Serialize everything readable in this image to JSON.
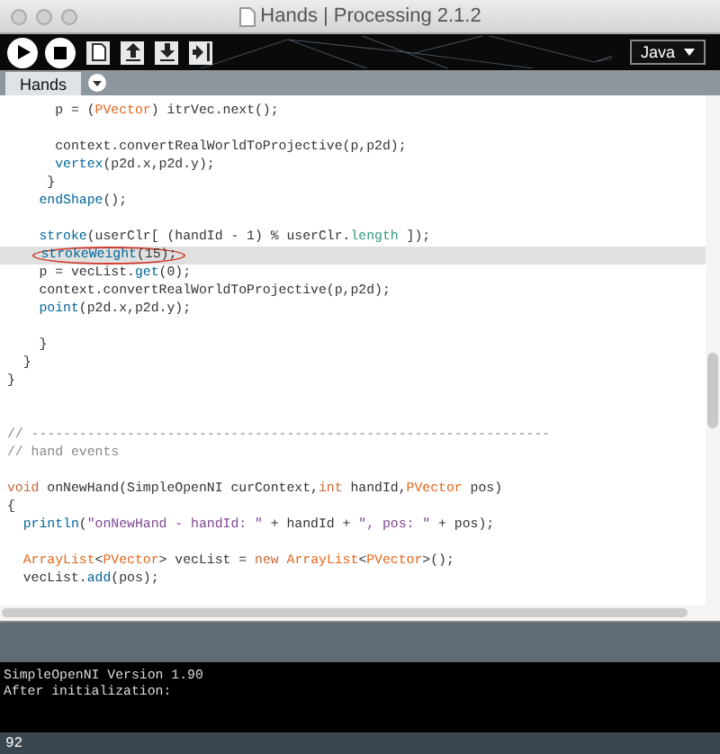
{
  "window": {
    "title": "Hands | Processing 2.1.2"
  },
  "toolbar": {
    "buttons": [
      {
        "kind": "run"
      },
      {
        "kind": "stop"
      },
      {
        "kind": "new"
      },
      {
        "kind": "open"
      },
      {
        "kind": "save"
      },
      {
        "kind": "export"
      }
    ],
    "mode": "Java"
  },
  "tabs": [
    {
      "label": "Hands",
      "selected": true
    }
  ],
  "editor": {
    "lines": [
      {
        "highlighted": false,
        "circled": false,
        "segs": [
          {
            "text": "      p = ("
          },
          {
            "text": "PVector",
            "kind": "type"
          },
          {
            "text": ") itrVec.next();"
          }
        ]
      },
      {
        "highlighted": false,
        "circled": false
      },
      {
        "highlighted": false,
        "circled": false,
        "segs": [
          {
            "text": "      context.convertRealWorldToProjective(p,p2d);"
          }
        ]
      },
      {
        "highlighted": false,
        "circled": false,
        "segs": [
          {
            "text": "      vertex",
            "kind": "func"
          },
          {
            "text": "(p2d.x,p2d.y);"
          }
        ]
      },
      {
        "highlighted": false,
        "circled": false,
        "segs": [
          {
            "text": "     }"
          }
        ]
      },
      {
        "highlighted": false,
        "circled": false,
        "segs": [
          {
            "text": "    endShape",
            "kind": "func"
          },
          {
            "text": "();"
          }
        ]
      },
      {
        "highlighted": false,
        "circled": false
      },
      {
        "highlighted": false,
        "circled": false,
        "segs": [
          {
            "text": "    stroke",
            "kind": "func"
          },
          {
            "text": "(userClr[ (handId - 1) % userClr."
          },
          {
            "text": "length",
            "kind": "field"
          },
          {
            "text": " ]);"
          }
        ]
      },
      {
        "highlighted": true,
        "circled": true,
        "segs": [
          {
            "text": "strokeWeight",
            "kind": "func"
          },
          {
            "text": "(15);"
          }
        ]
      },
      {
        "highlighted": false,
        "circled": false,
        "segs": [
          {
            "text": "    p = vecList."
          },
          {
            "text": "get",
            "kind": "func"
          },
          {
            "text": "(0);"
          }
        ]
      },
      {
        "highlighted": false,
        "circled": false,
        "segs": [
          {
            "text": "    context.convertRealWorldToProjective(p,p2d);"
          }
        ]
      },
      {
        "highlighted": false,
        "circled": false,
        "segs": [
          {
            "text": "    point",
            "kind": "func"
          },
          {
            "text": "(p2d.x,p2d.y);"
          }
        ]
      },
      {
        "highlighted": false,
        "circled": false
      },
      {
        "highlighted": false,
        "circled": false,
        "segs": [
          {
            "text": "    }"
          }
        ]
      },
      {
        "highlighted": false,
        "circled": false,
        "segs": [
          {
            "text": "  }"
          }
        ]
      },
      {
        "highlighted": false,
        "circled": false,
        "segs": [
          {
            "text": "}"
          }
        ]
      },
      {
        "highlighted": false,
        "circled": false
      },
      {
        "highlighted": false,
        "circled": false
      },
      {
        "highlighted": false,
        "circled": false,
        "segs": [
          {
            "text": "// -----------------------------------------------------------------",
            "kind": "comment"
          }
        ]
      },
      {
        "highlighted": false,
        "circled": false,
        "segs": [
          {
            "text": "// hand events",
            "kind": "comment"
          }
        ]
      },
      {
        "highlighted": false,
        "circled": false
      },
      {
        "highlighted": false,
        "circled": false,
        "segs": [
          {
            "text": "void",
            "kind": "kw"
          },
          {
            "text": " onNewHand(SimpleOpenNI curContext,"
          },
          {
            "text": "int",
            "kind": "kw"
          },
          {
            "text": " handId,"
          },
          {
            "text": "PVector",
            "kind": "type"
          },
          {
            "text": " pos)"
          }
        ]
      },
      {
        "highlighted": false,
        "circled": false,
        "segs": [
          {
            "text": "{"
          }
        ]
      },
      {
        "highlighted": false,
        "circled": false,
        "segs": [
          {
            "text": "  println",
            "kind": "func"
          },
          {
            "text": "("
          },
          {
            "text": "\"onNewHand - handId: \"",
            "kind": "string"
          },
          {
            "text": " + handId + "
          },
          {
            "text": "\", pos: \"",
            "kind": "string"
          },
          {
            "text": " + pos);"
          }
        ]
      },
      {
        "highlighted": false,
        "circled": false
      },
      {
        "highlighted": false,
        "circled": false,
        "segs": [
          {
            "text": "  ArrayList",
            "kind": "type"
          },
          {
            "text": "<"
          },
          {
            "text": "PVector",
            "kind": "type"
          },
          {
            "text": "> vecList = "
          },
          {
            "text": "new",
            "kind": "kw"
          },
          {
            "text": " ArrayList",
            "kind": "type"
          },
          {
            "text": "<"
          },
          {
            "text": "PVector",
            "kind": "type"
          },
          {
            "text": ">();"
          }
        ]
      },
      {
        "highlighted": false,
        "circled": false,
        "segs": [
          {
            "text": "  vecList."
          },
          {
            "text": "add",
            "kind": "func"
          },
          {
            "text": "(pos);"
          }
        ]
      }
    ]
  },
  "console": {
    "lines": [
      "SimpleOpenNI Version 1.90",
      "After initialization:"
    ]
  },
  "status_bar": {
    "line_number": "92"
  }
}
